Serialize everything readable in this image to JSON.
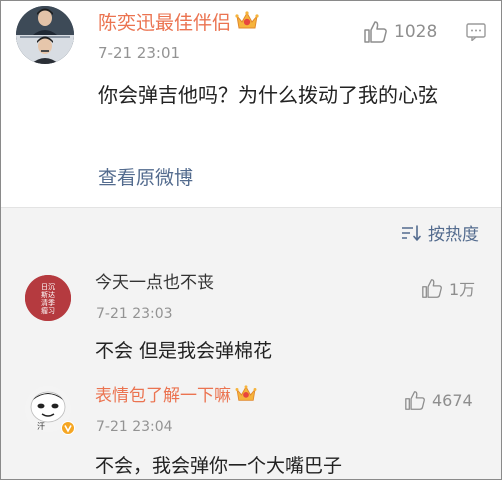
{
  "main_comment": {
    "username": "陈奕迅最佳伴侣",
    "time": "7-21 23:01",
    "likes": "1028",
    "text": "你会弹吉他吗？为什么拨动了我的心弦",
    "view_original": "查看原微博"
  },
  "sort_label": "按热度",
  "replies": [
    {
      "username": "今天一点也不丧",
      "time": "7-21 23:03",
      "likes": "1万",
      "text": "不会 但是我会弹棉花",
      "avatar_text": [
        "日沉",
        "斯达",
        "清季",
        "瘤习"
      ]
    },
    {
      "username": "表情包了解一下嘛",
      "time": "7-21 23:04",
      "likes": "4674",
      "text": "不会，我会弹你一个大嘴巴子",
      "avatar_caption": "汗"
    }
  ],
  "colors": {
    "username_orange": "#eb7350",
    "link_blue": "#536b8e",
    "meta_gray": "#939393",
    "reply_bg": "#f3f3f3"
  }
}
